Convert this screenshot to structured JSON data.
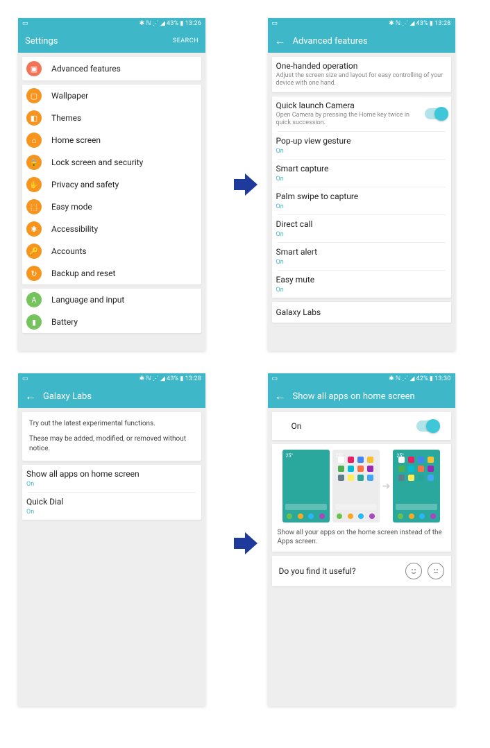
{
  "status": {
    "battery": "43%",
    "battery2": "42%",
    "t1": "13:26",
    "t2": "13:28",
    "t3": "13:28",
    "t4": "13:30"
  },
  "p1": {
    "title": "Settings",
    "search": "SEARCH",
    "featured": "Advanced features",
    "items_orange": [
      "Wallpaper",
      "Themes",
      "Home screen",
      "Lock screen and security",
      "Privacy and safety",
      "Easy mode",
      "Accessibility",
      "Accounts",
      "Backup and reset"
    ],
    "items_green": [
      "Language and input",
      "Battery"
    ]
  },
  "p2": {
    "title": "Advanced features",
    "top": {
      "title": "One-handed operation",
      "desc": "Adjust the screen size and layout for easy controlling of your device with one hand."
    },
    "qlc": {
      "title": "Quick launch Camera",
      "desc": "Open Camera by pressing the Home key twice in quick succession."
    },
    "rows": [
      {
        "title": "Pop-up view gesture",
        "status": "On"
      },
      {
        "title": "Smart capture",
        "status": "On"
      },
      {
        "title": "Palm swipe to capture",
        "status": "On"
      },
      {
        "title": "Direct call",
        "status": "On"
      },
      {
        "title": "Smart alert",
        "status": "On"
      },
      {
        "title": "Easy mute",
        "status": "On"
      }
    ],
    "labs": "Galaxy Labs"
  },
  "p3": {
    "title": "Galaxy Labs",
    "intro1": "Try out the latest experimental functions.",
    "intro2": "These may be added, modified, or removed without notice.",
    "rows": [
      {
        "title": "Show all apps on home screen",
        "status": "On"
      },
      {
        "title": "Quick Dial",
        "status": "On"
      }
    ]
  },
  "p4": {
    "title": "Show all apps on home screen",
    "on": "On",
    "desc": "Show all your apps on the home screen instead of the Apps screen.",
    "feedback": "Do you find it useful?"
  },
  "icons": {
    "orange": [
      "▢",
      "◧",
      "⌂",
      "🔒",
      "✋",
      "⬚",
      "✱",
      "🔑",
      "↻"
    ],
    "green": [
      "A",
      "▮"
    ]
  },
  "mini_colors": {
    "dock": [
      "#6cc14b",
      "#f9a825",
      "#29b6f6",
      "#ab47bc"
    ],
    "apps": [
      "#fff",
      "#e91e63",
      "#4285f4",
      "#fbc02d",
      "#4caf50",
      "#00bcd4",
      "#ff7043",
      "#9c27b0",
      "#607d8b",
      "#ffee58",
      "#26a69a",
      "#42a5f5"
    ]
  }
}
